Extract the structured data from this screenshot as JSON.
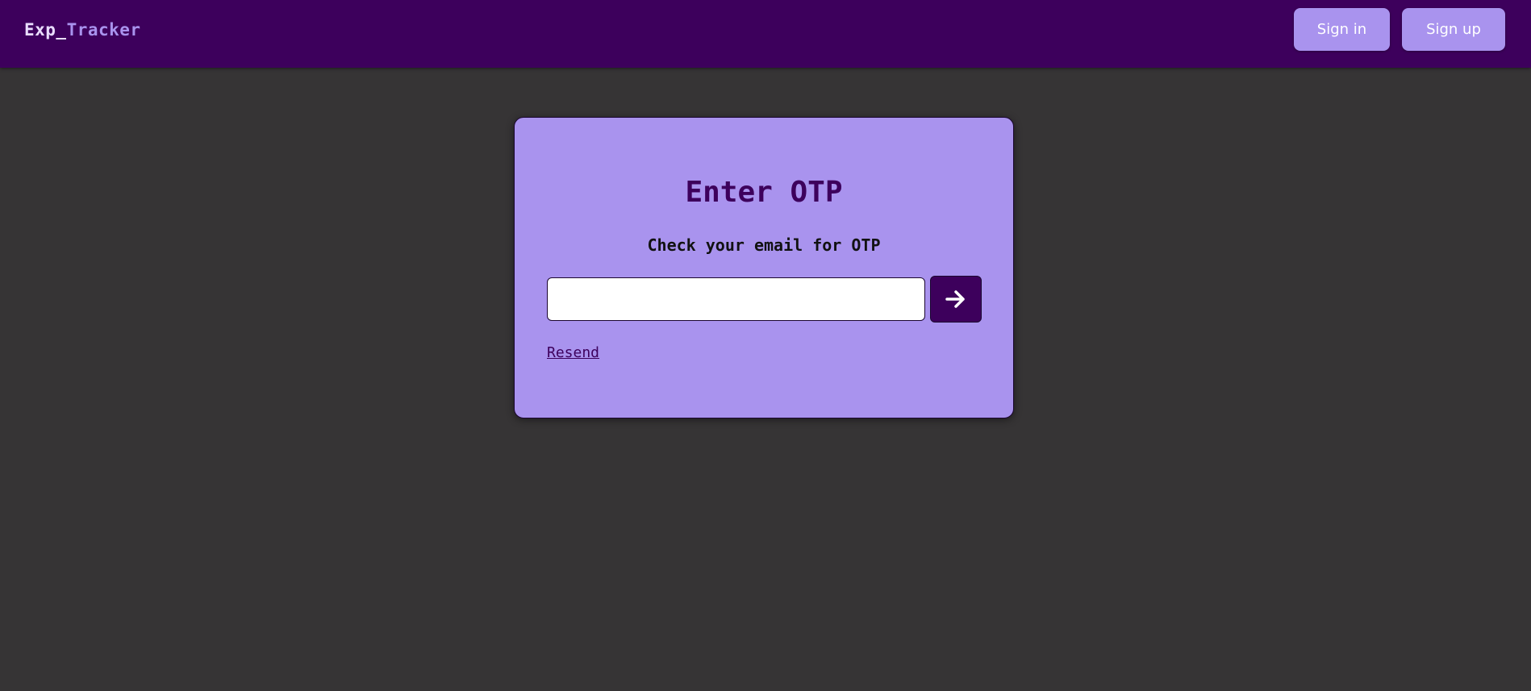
{
  "navbar": {
    "brand_part1": "Exp_",
    "brand_part2": "Tracker",
    "sign_in_label": "Sign in",
    "sign_up_label": "Sign up"
  },
  "otp_card": {
    "title": "Enter OTP",
    "subtitle": "Check your email for OTP",
    "input_value": "",
    "submit_icon": "arrow-right-icon",
    "resend_label": "Resend"
  },
  "colors": {
    "navbar_bg": "#3d005c",
    "page_bg": "#363435",
    "accent": "#a993ee",
    "brand_light": "#e9ddff"
  }
}
